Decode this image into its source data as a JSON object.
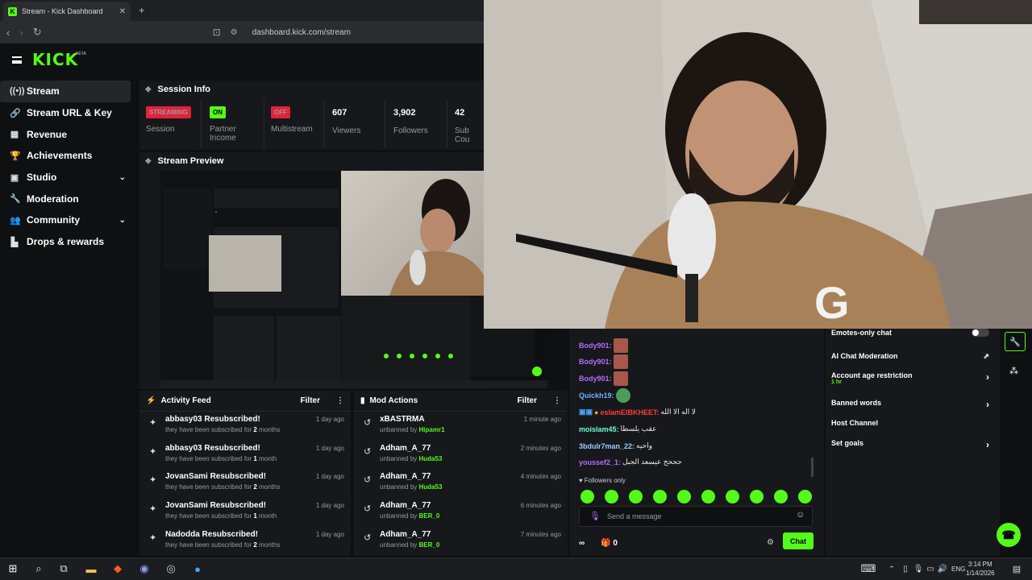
{
  "browser": {
    "tab_title": "Stream - Kick Dashboard",
    "tab_close": "✕",
    "new_tab": "+",
    "url": "dashboard.kick.com/stream"
  },
  "brand": {
    "logo": "KICK",
    "beta": "BETA",
    "accent": "#53fc18"
  },
  "sidebar": {
    "items": [
      {
        "label": "Stream",
        "icon": "broadcast-icon",
        "glyph": "((•))",
        "active": true
      },
      {
        "label": "Stream URL & Key",
        "icon": "link-icon",
        "glyph": "🔗"
      },
      {
        "label": "Revenue",
        "icon": "revenue-icon",
        "glyph": "▦"
      },
      {
        "label": "Achievements",
        "icon": "trophy-icon",
        "glyph": "🏆"
      },
      {
        "label": "Studio",
        "icon": "studio-icon",
        "glyph": "▣",
        "chevron": "⌄"
      },
      {
        "label": "Moderation",
        "icon": "wrench-icon",
        "glyph": "🔧"
      },
      {
        "label": "Community",
        "icon": "people-icon",
        "glyph": "👥",
        "chevron": "⌄"
      },
      {
        "label": "Drops & rewards",
        "icon": "drops-icon",
        "glyph": "▙"
      }
    ]
  },
  "session": {
    "title": "Session Info",
    "streaming_badge": "STREAMING",
    "session_label": "Session",
    "partner_badge": "ON",
    "partner_label": "Partner Income",
    "multistream_badge": "OFF",
    "multistream_label": "Multistream",
    "viewers": "607",
    "viewers_label": "Viewers",
    "followers": "3,902",
    "followers_label": "Followers",
    "subs": "42",
    "subs_label": "Sub Cou"
  },
  "preview": {
    "title": "Stream Preview"
  },
  "activity": {
    "title": "Activity Feed",
    "filter": "Filter",
    "menu": "⋮",
    "rows": [
      {
        "title": "abbasy03 Resubscribed!",
        "pre": "they have been subscribed for ",
        "num": "2",
        "post": " months",
        "when": "1 day ago"
      },
      {
        "title": "abbasy03 Resubscribed!",
        "pre": "they have been subscribed for ",
        "num": "1",
        "post": " month",
        "when": "1 day ago"
      },
      {
        "title": "JovanSami Resubscribed!",
        "pre": "they have been subscribed for ",
        "num": "2",
        "post": " months",
        "when": "1 day ago"
      },
      {
        "title": "JovanSami Resubscribed!",
        "pre": "they have been subscribed for ",
        "num": "1",
        "post": " month",
        "when": "1 day ago"
      },
      {
        "title": "Nadodda Resubscribed!",
        "pre": "they have been subscribed for ",
        "num": "2",
        "post": " months",
        "when": "1 day ago"
      }
    ]
  },
  "mod_actions": {
    "title": "Mod Actions",
    "filter": "Filter",
    "menu": "⋮",
    "rows": [
      {
        "title": "xBASTRMA",
        "pre": "unbanned by ",
        "by": "Hipamr1",
        "when": "1 minute ago"
      },
      {
        "title": "Adham_A_77",
        "pre": "unbanned by ",
        "by": "Huda53",
        "when": "2 minutes ago"
      },
      {
        "title": "Adham_A_77",
        "pre": "unbanned by ",
        "by": "Huda53",
        "when": "4 minutes ago"
      },
      {
        "title": "Adham_A_77",
        "pre": "unbanned by ",
        "by": "BER_0",
        "when": "6 minutes ago"
      },
      {
        "title": "Adham_A_77",
        "pre": "unbanned by ",
        "by": "BER_0",
        "when": "7 minutes ago"
      }
    ]
  },
  "chat": {
    "messages": [
      {
        "user": "Body901:",
        "color": "#b26cff",
        "text": ""
      },
      {
        "user": "Body901:",
        "color": "#b26cff",
        "text": ""
      },
      {
        "user": "Body901:",
        "color": "#b26cff",
        "text": ""
      },
      {
        "user": "Quickh19:",
        "color": "#6cb2ff",
        "text": ""
      },
      {
        "user": "eslamElBKHEET:",
        "color": "#ff3b3b",
        "text": "لا اله الا الله"
      },
      {
        "user": "moislam45:",
        "color": "#6cffd2",
        "text": "عقب يلسطا"
      },
      {
        "user": "3bdulr7man_22:",
        "color": "#9ad0ff",
        "text": "واحيه"
      },
      {
        "user": "youssef2_1:",
        "color": "#b26cff",
        "text": "حححح عيسعد الجبل"
      }
    ],
    "followers_only": "Followers only",
    "placeholder": "Send a message",
    "count": "0",
    "send": "Chat"
  },
  "mod_panel": {
    "emotes_only": "Emotes-only chat",
    "ai_moderation": "AI Chat Moderation",
    "age_restriction": "Account age restriction",
    "age_value": "1 hr",
    "banned_words": "Banned words",
    "host_channel": "Host Channel",
    "set_goals": "Set goals"
  },
  "taskbar": {
    "time": "3:14 PM",
    "date": "1/14/2026",
    "lang": "ENG"
  }
}
